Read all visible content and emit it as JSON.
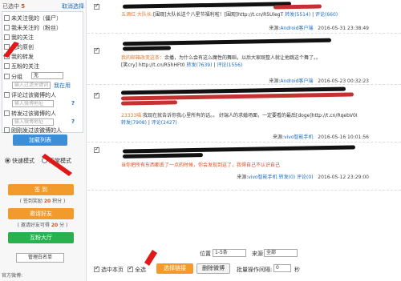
{
  "selection": {
    "prefix": "已选中",
    "count": "5",
    "cancel": "取消选择"
  },
  "filters": {
    "not_followed_me": "未关注我的（僵尸）",
    "i_not_followed": "我未关注的（粉丝）",
    "my_following": "我的关注",
    "my_original": "我的原创",
    "my_reposts": "我的转发",
    "group_label": "分组",
    "group_value": "无",
    "comment_filter": "评论过该微博的人",
    "comment_placeholder": "输入微博地址",
    "repost_filter": "转发过该微博的人",
    "repost_placeholder": "输入微博地址",
    "posted_filter": "刚刚发过该微博的人",
    "keyword_placeholder": "输入过滤关键词",
    "keyword_link": "我在用"
  },
  "load_button": "加载列表",
  "mode": {
    "fast": "快速模式",
    "normal": "正常模式"
  },
  "signin": {
    "label": "签 到",
    "note_prefix": "( 签到奖励 ",
    "note_value": "20",
    "note_suffix": " 积分 )"
  },
  "invite": {
    "label": "邀请好友",
    "note_prefix": "( 邀请好友可得 ",
    "note_value": "20",
    "note_suffix": " 分 )"
  },
  "interact": "互粉大厅",
  "whitelist": "管理白名单",
  "footer_left": "官方微博:",
  "posts": [
    {
      "line1": "五酒红·大队长:",
      "line1_rest": "[围观]大队长送个八星节福利啦！[围观]http://t.cn/R5UlegT",
      "repost": "转发(5514)",
      "comment": "评论(660)",
      "source_label": "来源:",
      "source": "Android客户端",
      "time": "2016-05-31 23:38:49"
    },
    {
      "line1": "我的邮箱改变这条：",
      "line1_rest": "余播，为什么会有这么魔性的舞蹈，以后大家既整人就让他跳这个舞了。。",
      "line2": "[笑cry] http://t.cn/R5hHFt0",
      "repost": "转发(7639)",
      "comment": "评论(1556)",
      "source_label": "来源:",
      "source": "Android客户端",
      "time": "2016-05-23 00:32:23"
    },
    {
      "line1": "23333喵:",
      "line1_rest": "我现在就告诉你我心里所有的话。。 好端人的求婚场面，一定要看的最后[doge]http://t.cn/RqebV0I",
      "repost": "转发(7908)",
      "comment": "评论(2427)",
      "source_label": "来源:",
      "source": "vivo智能手机",
      "time": "2016-05-16 10:01:56"
    },
    {
      "line1": "当你把所有东西都丢了一点的时候，你会发现到这了，我得自己不认识自己",
      "source_label": "来源:",
      "source": "vivo智能手机",
      "repost": "转发(0)",
      "comment": "评论(0)",
      "time": "2016-05-12 23:29:00"
    }
  ],
  "bottom": {
    "position_label": "位置",
    "position_value": "1-5条",
    "source_label": "来源",
    "source_value": "全部",
    "select_page": "选中本页",
    "select_all": "全选",
    "select_link": "选择链接",
    "delete": "删除微博",
    "interval_label": "批量操作间隔:",
    "interval_value": "0",
    "interval_unit": "秒"
  },
  "colors": {
    "accent_blue": "#3a8fd8",
    "orange": "#f39a2c",
    "green": "#29b04f",
    "red": "#e04a1a"
  }
}
